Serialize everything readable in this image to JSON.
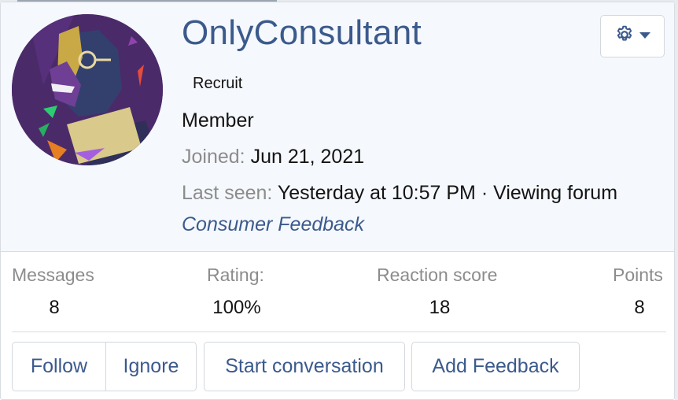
{
  "profile": {
    "username": "OnlyConsultant",
    "user_title": "Recruit",
    "banner": "Member",
    "joined_label": "Joined:",
    "joined_value": "Jun 21, 2021",
    "last_seen_label": "Last seen:",
    "last_seen_value": "Yesterday at 10:57 PM · Viewing forum",
    "forum_link": "Consumer Feedback",
    "avatar_icon": "avatar-image"
  },
  "menu": {
    "icon": "gear-icon",
    "caret_icon": "caret-down-icon"
  },
  "stats": [
    {
      "label": "Messages",
      "value": "8"
    },
    {
      "label": "Rating:",
      "value": "100%"
    },
    {
      "label": "Reaction score",
      "value": "18"
    },
    {
      "label": "Points",
      "value": "8"
    }
  ],
  "actions": {
    "follow": "Follow",
    "ignore": "Ignore",
    "start_conversation": "Start conversation",
    "add_feedback": "Add Feedback"
  },
  "colors": {
    "link": "#3b5a8c",
    "muted": "#8c8c8c",
    "header_bg": "#f5f8fc",
    "border": "#d8dde3"
  }
}
